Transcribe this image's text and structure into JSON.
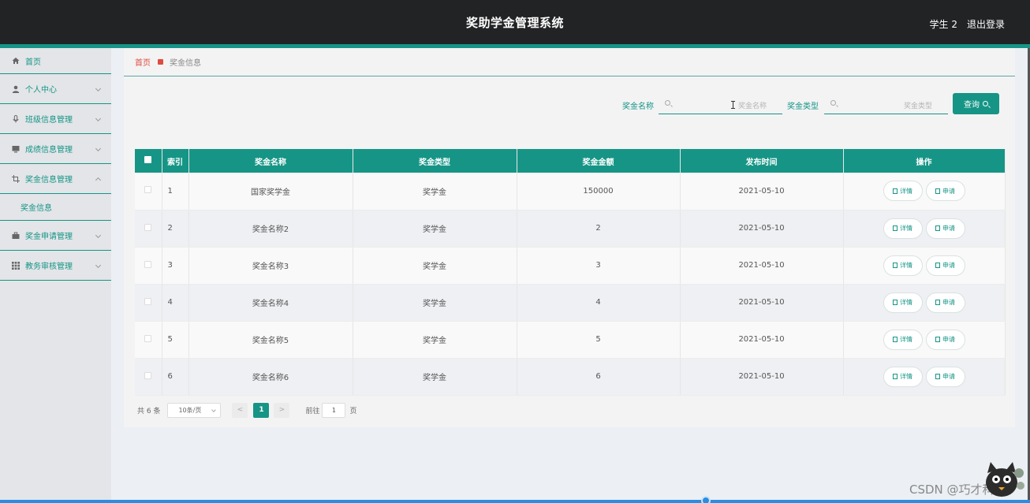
{
  "header": {
    "title": "奖助学金管理系统",
    "user": "学生 2",
    "logout": "退出登录"
  },
  "sidebar": {
    "home": {
      "label": "首页",
      "icon": "home-icon"
    },
    "items": [
      {
        "label": "个人中心",
        "icon": "user-icon"
      },
      {
        "label": "班级信息管理",
        "icon": "microphone-icon"
      },
      {
        "label": "成绩信息管理",
        "icon": "monitor-icon"
      },
      {
        "label": "奖金信息管理",
        "icon": "crop-icon",
        "expanded": true
      },
      {
        "label": "奖金申请管理",
        "icon": "briefcase-icon"
      },
      {
        "label": "教务审核管理",
        "icon": "grid-icon"
      }
    ],
    "submenu": {
      "label": "奖金信息"
    }
  },
  "breadcrumb": {
    "home": "首页",
    "current": "奖金信息"
  },
  "search": {
    "name_label": "奖金名称",
    "name_placeholder": "奖金名称",
    "type_label": "奖金类型",
    "type_placeholder": "奖金类型",
    "button": "查询"
  },
  "table": {
    "columns": [
      "索引",
      "奖金名称",
      "奖金类型",
      "奖金金额",
      "发布时间",
      "操作"
    ],
    "rows": [
      {
        "index": "1",
        "name": "国家奖学金",
        "type": "奖学金",
        "amount": "150000",
        "date": "2021-05-10"
      },
      {
        "index": "2",
        "name": "奖金名称2",
        "type": "奖学金",
        "amount": "2",
        "date": "2021-05-10"
      },
      {
        "index": "3",
        "name": "奖金名称3",
        "type": "奖学金",
        "amount": "3",
        "date": "2021-05-10"
      },
      {
        "index": "4",
        "name": "奖金名称4",
        "type": "奖学金",
        "amount": "4",
        "date": "2021-05-10"
      },
      {
        "index": "5",
        "name": "奖金名称5",
        "type": "奖学金",
        "amount": "5",
        "date": "2021-05-10"
      },
      {
        "index": "6",
        "name": "奖金名称6",
        "type": "奖学金",
        "amount": "6",
        "date": "2021-05-10"
      }
    ],
    "action_detail": "详情",
    "action_apply": "申请"
  },
  "pagination": {
    "total": "共 6 条",
    "page_size": "10条/页",
    "prev": "<",
    "current": "1",
    "next": ">",
    "goto_label": "前往",
    "goto_value": "1",
    "goto_suffix": "页"
  },
  "watermark": "CSDN @巧才科技",
  "colors": {
    "accent": "#169586",
    "topbar": "#222325",
    "breadcrumb_home": "#e04b3f"
  }
}
